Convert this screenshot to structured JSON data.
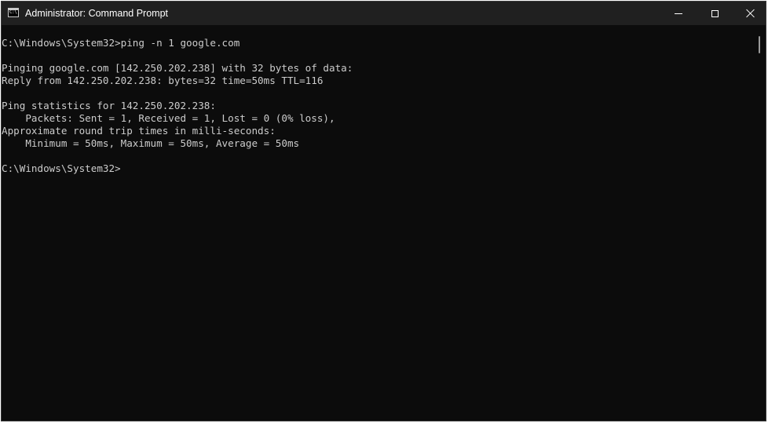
{
  "window": {
    "title": "Administrator: Command Prompt",
    "icon": "cmd-app-icon",
    "icon_text": "C:\\",
    "controls": {
      "minimize": "minimize-icon",
      "maximize": "maximize-icon",
      "close": "close-icon"
    }
  },
  "console": {
    "lines": [
      "C:\\Windows\\System32>ping -n 1 google.com",
      "",
      "Pinging google.com [142.250.202.238] with 32 bytes of data:",
      "Reply from 142.250.202.238: bytes=32 time=50ms TTL=116",
      "",
      "Ping statistics for 142.250.202.238:",
      "    Packets: Sent = 1, Received = 1, Lost = 0 (0% loss),",
      "Approximate round trip times in milli-seconds:",
      "    Minimum = 50ms, Maximum = 50ms, Average = 50ms",
      "",
      "C:\\Windows\\System32>"
    ]
  },
  "colors": {
    "titlebar": "#202020",
    "console_bg": "#0c0c0c",
    "console_fg": "#cccccc"
  }
}
